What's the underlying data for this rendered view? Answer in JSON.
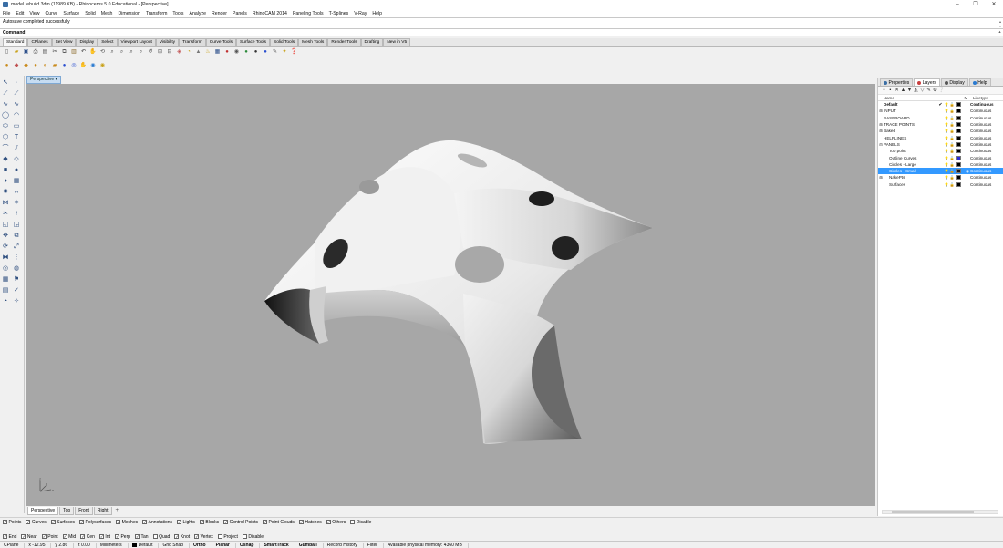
{
  "window": {
    "title": "model rebuild.3dm (11989 KB) - Rhinoceros 5.0 Educational - [Perspective]",
    "controls": [
      "–",
      "❐",
      "✕"
    ]
  },
  "menu": [
    "File",
    "Edit",
    "View",
    "Curve",
    "Surface",
    "Solid",
    "Mesh",
    "Dimension",
    "Transform",
    "Tools",
    "Analyze",
    "Render",
    "Panels",
    "RhinoCAM 2014",
    "Paneling Tools",
    "T-Splines",
    "V-Ray",
    "Help"
  ],
  "command_history": "Autosave completed successfully",
  "command_prompt": "Command:",
  "toolbar_tabs": [
    "Standard",
    "CPlanes",
    "Set View",
    "Display",
    "Select",
    "Viewport Layout",
    "Visibility",
    "Transform",
    "Curve Tools",
    "Surface Tools",
    "Solid Tools",
    "Mesh Tools",
    "Render Tools",
    "Drafting",
    "New in V5"
  ],
  "viewport": {
    "label": "Perspective",
    "tabs": [
      "Perspective",
      "Top",
      "Front",
      "Right"
    ],
    "add_tab": "+",
    "axis_labels": {
      "x": "x",
      "y": "y",
      "z": "z"
    }
  },
  "filters": [
    {
      "label": "Points",
      "checked": true
    },
    {
      "label": "Curves",
      "checked": true
    },
    {
      "label": "Surfaces",
      "checked": true
    },
    {
      "label": "Polysurfaces",
      "checked": true
    },
    {
      "label": "Meshes",
      "checked": true
    },
    {
      "label": "Annotations",
      "checked": true
    },
    {
      "label": "Lights",
      "checked": true
    },
    {
      "label": "Blocks",
      "checked": true
    },
    {
      "label": "Control Points",
      "checked": true
    },
    {
      "label": "Point Clouds",
      "checked": true
    },
    {
      "label": "Hatches",
      "checked": true
    },
    {
      "label": "Others",
      "checked": true
    },
    {
      "label": "Disable",
      "checked": false
    }
  ],
  "osnaps": [
    {
      "label": "End",
      "checked": true
    },
    {
      "label": "Near",
      "checked": true
    },
    {
      "label": "Point",
      "checked": true
    },
    {
      "label": "Mid",
      "checked": true
    },
    {
      "label": "Cen",
      "checked": true
    },
    {
      "label": "Int",
      "checked": true
    },
    {
      "label": "Perp",
      "checked": true
    },
    {
      "label": "Tan",
      "checked": true
    },
    {
      "label": "Quad",
      "checked": false
    },
    {
      "label": "Knot",
      "checked": true
    },
    {
      "label": "Vertex",
      "checked": true
    },
    {
      "label": "Project",
      "checked": false
    },
    {
      "label": "Disable",
      "checked": false
    }
  ],
  "status": {
    "cplane": "CPlane",
    "x": "x -12.95",
    "y": "y 2.86",
    "z": "z 0.00",
    "units": "Millimeters",
    "layer": "Default",
    "grid_snap": "Grid Snap",
    "ortho": "Ortho",
    "planar": "Planar",
    "osnap": "Osnap",
    "smarttrack": "SmartTrack",
    "gumball": "Gumball",
    "record_history": "Record History",
    "filter": "Filter",
    "memory": "Available physical memory: 4360 MB"
  },
  "panel": {
    "tabs": [
      "Properties",
      "Layers",
      "Display",
      "Help"
    ],
    "columns": {
      "name": "Name",
      "material": "M",
      "linetype": "Linetype"
    },
    "layers": [
      {
        "name": "Default",
        "expander": "",
        "current": "✔",
        "color": "#000000",
        "linetype": "Continuous",
        "bold": true,
        "selected": false,
        "indent": 0
      },
      {
        "name": "INPUT",
        "expander": "⊞",
        "current": "",
        "color": "#000000",
        "linetype": "Continuous",
        "bold": false,
        "selected": false,
        "indent": 0
      },
      {
        "name": "BASEBOARD",
        "expander": "",
        "current": "",
        "color": "#000000",
        "linetype": "Continuous",
        "bold": false,
        "selected": false,
        "indent": 0
      },
      {
        "name": "TRACE POINTS",
        "expander": "⊞",
        "current": "",
        "color": "#000000",
        "linetype": "Continuous",
        "bold": false,
        "selected": false,
        "indent": 0
      },
      {
        "name": "Baked",
        "expander": "⊞",
        "current": "",
        "color": "#000000",
        "linetype": "Continuous",
        "bold": false,
        "selected": false,
        "indent": 0
      },
      {
        "name": "HELPLINES",
        "expander": "",
        "current": "",
        "color": "#000000",
        "linetype": "Continuous",
        "bold": false,
        "selected": false,
        "indent": 0
      },
      {
        "name": "PANELS",
        "expander": "⊟",
        "current": "",
        "color": "#000000",
        "linetype": "Continuous",
        "bold": false,
        "selected": false,
        "indent": 0
      },
      {
        "name": "Top point",
        "expander": "",
        "current": "",
        "color": "#000000",
        "linetype": "Continuous",
        "bold": false,
        "selected": false,
        "indent": 1
      },
      {
        "name": "Outline Curves",
        "expander": "",
        "current": "",
        "color": "#2b2bd8",
        "linetype": "Continuous",
        "bold": false,
        "selected": false,
        "indent": 1
      },
      {
        "name": "Circles - Large",
        "expander": "",
        "current": "",
        "color": "#000000",
        "linetype": "Continuous",
        "bold": false,
        "selected": false,
        "indent": 1
      },
      {
        "name": "Circles - Small",
        "expander": "",
        "current": "",
        "color": "#1a1a1a",
        "linetype": "Continuous",
        "bold": false,
        "selected": true,
        "indent": 1
      },
      {
        "name": "NakePts",
        "expander": "⊞",
        "current": "",
        "color": "#000000",
        "linetype": "Continuous",
        "bold": false,
        "selected": false,
        "indent": 1
      },
      {
        "name": "Surfaces",
        "expander": "",
        "current": "",
        "color": "#000000",
        "linetype": "Continuous",
        "bold": false,
        "selected": false,
        "indent": 1
      }
    ]
  },
  "colors": {
    "viewport_bg": "#a7a7a7",
    "selection": "#3399ff",
    "active_viewport_tab": "#c6dcf2"
  }
}
